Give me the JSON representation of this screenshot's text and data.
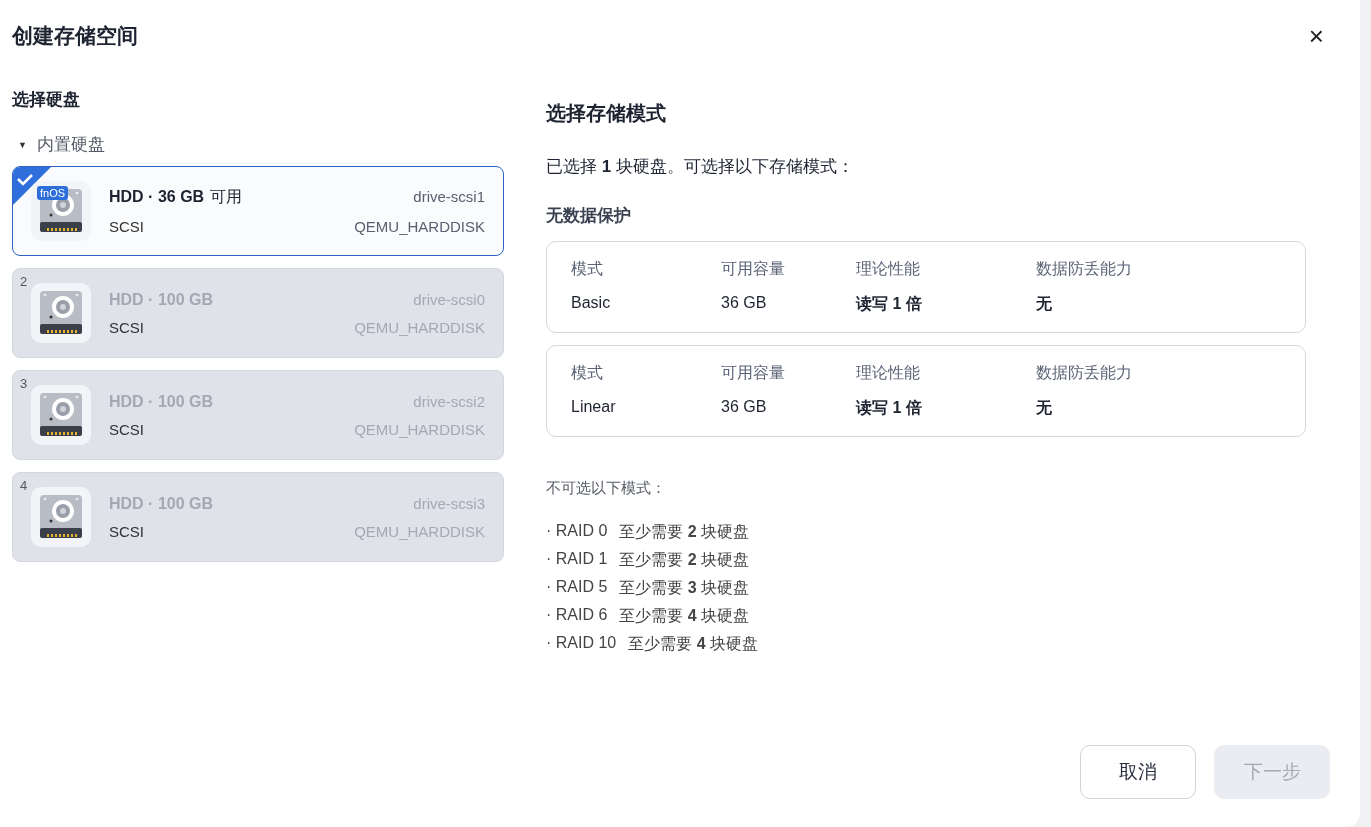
{
  "dialog": {
    "title": "创建存储空间",
    "close": "×"
  },
  "disk_panel": {
    "heading": "选择硬盘",
    "group": {
      "label": "内置硬盘",
      "expanded": true,
      "toggle": "▼"
    },
    "disks": [
      {
        "title": "HDD · 36 GB",
        "suffix": "可用",
        "id": "drive-scsi1",
        "bus": "SCSI",
        "model": "QEMU_HARDDISK",
        "badge": "fnOS",
        "selected": true,
        "disabled": false
      },
      {
        "number": "2",
        "title": "HDD · 100 GB",
        "id": "drive-scsi0",
        "bus": "SCSI",
        "model": "QEMU_HARDDISK",
        "selected": false,
        "disabled": true
      },
      {
        "number": "3",
        "title": "HDD · 100 GB",
        "id": "drive-scsi2",
        "bus": "SCSI",
        "model": "QEMU_HARDDISK",
        "selected": false,
        "disabled": true
      },
      {
        "number": "4",
        "title": "HDD · 100 GB",
        "id": "drive-scsi3",
        "bus": "SCSI",
        "model": "QEMU_HARDDISK",
        "selected": false,
        "disabled": true
      }
    ]
  },
  "mode_panel": {
    "heading": "选择存储模式",
    "intro": "已选择 **1** 块硬盘。可选择以下存储模式：",
    "section": "无数据保护",
    "modes": [
      {
        "fields": [
          {
            "label": "模式",
            "value": "Basic",
            "emphasis": false
          },
          {
            "label": "可用容量",
            "value": "36 GB",
            "emphasis": false
          },
          {
            "label": "理论性能",
            "value": "读写 1 倍",
            "emphasis": true
          },
          {
            "label": "数据防丢能力",
            "value": "无",
            "emphasis": true
          }
        ]
      },
      {
        "fields": [
          {
            "label": "模式",
            "value": "Linear",
            "emphasis": false
          },
          {
            "label": "可用容量",
            "value": "36 GB",
            "emphasis": false
          },
          {
            "label": "理论性能",
            "value": "读写 1 倍",
            "emphasis": true
          },
          {
            "label": "数据防丢能力",
            "value": "无",
            "emphasis": true
          }
        ]
      }
    ],
    "unavailable_heading": "不可选以下模式：",
    "unavailable": [
      {
        "name": "· RAID 0",
        "requirement": "至少需要 **2** 块硬盘"
      },
      {
        "name": "· RAID 1",
        "requirement": "至少需要 **2** 块硬盘"
      },
      {
        "name": "· RAID 5",
        "requirement": "至少需要 **3** 块硬盘"
      },
      {
        "name": "· RAID 6",
        "requirement": "至少需要 **4** 块硬盘"
      },
      {
        "name": "· RAID 10",
        "requirement": "至少需要 **4** 块硬盘"
      }
    ]
  },
  "footer": {
    "buttons": [
      {
        "label": "取消",
        "disabled": false
      },
      {
        "label": "下一步",
        "disabled": true
      }
    ]
  }
}
